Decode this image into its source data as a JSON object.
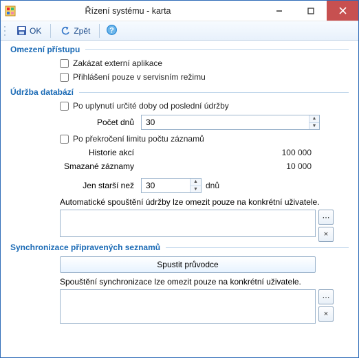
{
  "window": {
    "title": "Řízení systému - karta"
  },
  "toolbar": {
    "ok": "OK",
    "back": "Zpět"
  },
  "groups": {
    "access": {
      "title": "Omezení přístupu",
      "disable_ext": "Zakázat externí aplikace",
      "service_mode": "Přihlášení pouze v servisním režimu"
    },
    "maint": {
      "title": "Údržba databází",
      "after_days": "Po uplynutí určité doby od poslední údržby",
      "days_label": "Počet dnů",
      "days_value": "30",
      "over_limit": "Po překročení limitu počtu záznamů",
      "history_label": "Historie akcí",
      "history_value": "100 000",
      "deleted_label": "Smazané záznamy",
      "deleted_value": "10 000",
      "older_label": "Jen starší než",
      "older_value": "30",
      "older_unit": "dnů",
      "note": "Automatické spouštění údržby lze omezit pouze na konkrétní uživatele."
    },
    "sync": {
      "title": "Synchronizace připravených seznamů",
      "wizard": "Spustit průvodce",
      "note": "Spouštění synchronizace lze omezit pouze na konkrétní uživatele."
    }
  }
}
